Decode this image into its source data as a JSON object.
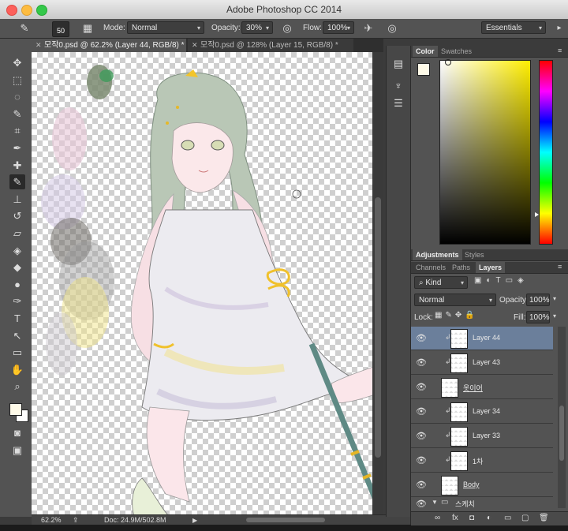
{
  "app": {
    "title": "Adobe Photoshop CC 2014",
    "window_buttons": [
      "close",
      "minimize",
      "maximize"
    ]
  },
  "options_bar": {
    "brush_size": "50",
    "mode_label": "Mode:",
    "mode_value": "Normal",
    "opacity_label": "Opacity:",
    "opacity_value": "30%",
    "flow_label": "Flow:",
    "flow_value": "100%",
    "workspace": "Essentials"
  },
  "tabs": [
    {
      "label": "모작0.psd @ 62.2% (Layer 44, RGB/8) *",
      "active": true
    },
    {
      "label": "모작0.psd @ 128% (Layer 15, RGB/8) *",
      "active": false
    }
  ],
  "tools": [
    "move-icon",
    "marquee-icon",
    "lasso-icon",
    "quick-select-icon",
    "crop-icon",
    "eyedropper-icon",
    "healing-icon",
    "brush-icon",
    "stamp-icon",
    "history-brush-icon",
    "eraser-icon",
    "paint-bucket-icon",
    "blur-icon",
    "dodge-icon",
    "pen-icon",
    "type-icon",
    "path-select-icon",
    "rectangle-icon",
    "hand-icon",
    "zoom-icon"
  ],
  "status": {
    "zoom": "62.2%",
    "doc": "Doc: 24.9M/502.8M"
  },
  "color_panel": {
    "tabs": [
      "Color",
      "Swatches"
    ],
    "hue_color": "#ffee00"
  },
  "adjust_panel": {
    "tabs": [
      "Adjustments",
      "Styles"
    ]
  },
  "layers_panel": {
    "tabs": [
      "Channels",
      "Paths",
      "Layers"
    ],
    "kind_label": "Kind",
    "blend_mode": "Normal",
    "opacity_label": "Opacity:",
    "opacity_value": "100%",
    "lock_label": "Lock:",
    "fill_label": "Fill:",
    "fill_value": "100%",
    "layers": [
      {
        "name": "Layer 44",
        "clipped": true,
        "selected": true
      },
      {
        "name": "Layer 43",
        "clipped": true,
        "selected": false
      },
      {
        "name": "옷이어",
        "clipped": false,
        "selected": false
      },
      {
        "name": "Layer 34",
        "clipped": true,
        "selected": false
      },
      {
        "name": "Layer 33",
        "clipped": true,
        "selected": false
      },
      {
        "name": "1차",
        "clipped": true,
        "selected": false
      },
      {
        "name": "Body",
        "clipped": false,
        "selected": false
      }
    ],
    "group_name": "스케치"
  }
}
